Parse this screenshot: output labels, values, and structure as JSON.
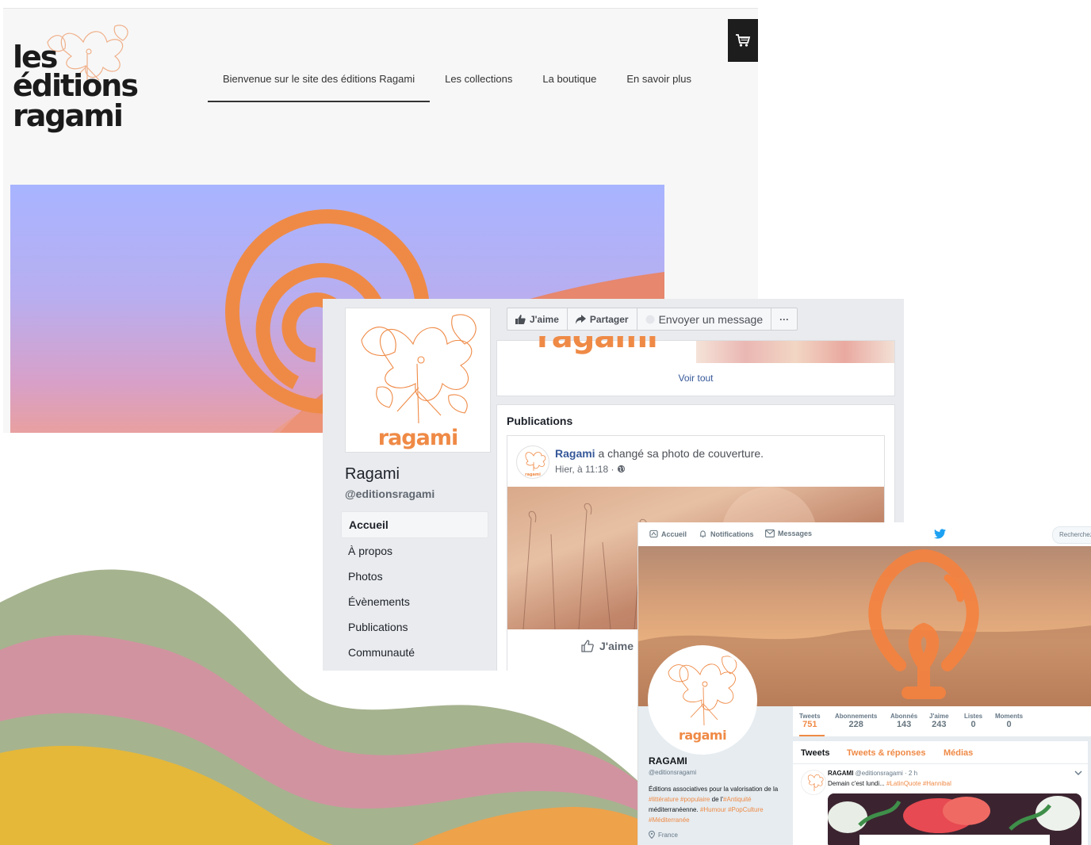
{
  "website": {
    "logo_lines": [
      "les",
      "éditions",
      "ragami"
    ],
    "nav": [
      {
        "label": "Bienvenue sur le site des éditions Ragami",
        "active": true
      },
      {
        "label": "Les collections",
        "active": false
      },
      {
        "label": "La boutique",
        "active": false
      },
      {
        "label": "En savoir plus",
        "active": false
      }
    ],
    "cart_icon": "shopping-cart-icon"
  },
  "facebook": {
    "avatar_text": "ragami",
    "page_name": "Ragami",
    "handle": "@editionsragami",
    "menu": [
      {
        "label": "Accueil",
        "active": true
      },
      {
        "label": "À propos",
        "active": false
      },
      {
        "label": "Photos",
        "active": false
      },
      {
        "label": "Évènements",
        "active": false
      },
      {
        "label": "Publications",
        "active": false
      },
      {
        "label": "Communauté",
        "active": false
      }
    ],
    "actions": {
      "like": "J'aime",
      "share": "Partager",
      "message": "Envoyer un message",
      "more": "···"
    },
    "photos_cover_text": "ragami",
    "see_all": "Voir tout",
    "publications_title": "Publications",
    "post": {
      "author": "Ragami",
      "action": " a changé sa photo de couverture.",
      "time": "Hier, à 11:18 · ",
      "avatar_text": "ragami",
      "like_label": "J'aime"
    }
  },
  "twitter": {
    "nav": {
      "home": "Accueil",
      "notifications": "Notifications",
      "messages": "Messages",
      "search_placeholder": "Recherchez"
    },
    "avatar_text": "ragami",
    "stats": [
      {
        "label": "Tweets",
        "value": "751",
        "active": true
      },
      {
        "label": "Abonnements",
        "value": "228",
        "active": false
      },
      {
        "label": "Abonnés",
        "value": "143",
        "active": false
      },
      {
        "label": "J'aime",
        "value": "243",
        "active": false
      },
      {
        "label": "Listes",
        "value": "0",
        "active": false
      },
      {
        "label": "Moments",
        "value": "0",
        "active": false
      }
    ],
    "profile": {
      "name": "RAGAMI",
      "handle": "@editionsragami",
      "bio_parts": [
        {
          "text": "Éditions associatives pour la valorisation de la ",
          "tag": false
        },
        {
          "text": "#littérature #populaire",
          "tag": true
        },
        {
          "text": " de l'",
          "tag": false
        },
        {
          "text": "#Antiquité",
          "tag": true
        },
        {
          "text": " méditerranéenne. ",
          "tag": false
        },
        {
          "text": "#Humour #PopCulture #Méditerranée",
          "tag": true
        }
      ],
      "location": "France"
    },
    "tabs": [
      {
        "label": "Tweets",
        "active": true
      },
      {
        "label": "Tweets & réponses",
        "active": false
      },
      {
        "label": "Médias",
        "active": false
      }
    ],
    "tweet": {
      "author": "RAGAMI",
      "meta": " @editionsragami · 2 h",
      "text": "Demain c'est lundi... ",
      "tags": "#LatinQuote #Hannibal"
    }
  },
  "colors": {
    "brand_orange": "#ef8a46",
    "fb_link": "#365899",
    "wave_green": "#a6b38f",
    "wave_pink": "#d193a0",
    "wave_yellow": "#e5b83a",
    "wave_orange": "#eea24a"
  }
}
